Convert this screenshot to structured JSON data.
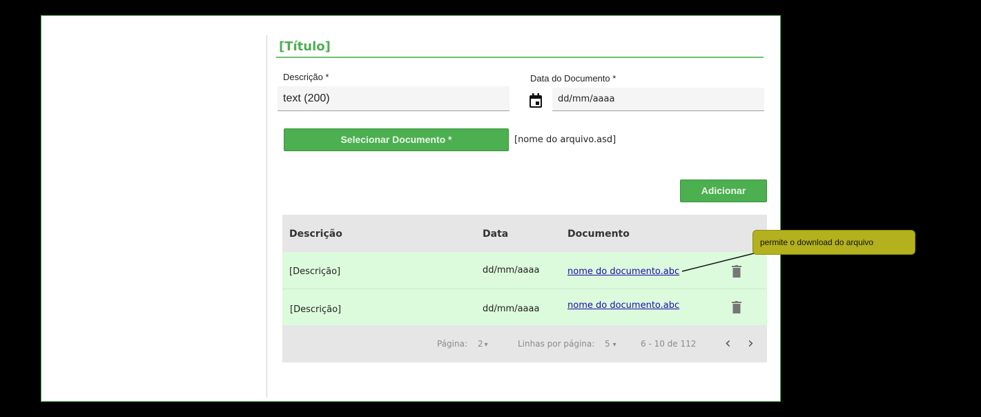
{
  "form": {
    "title": "[Título]",
    "descricao_label": "Descrição *",
    "descricao_value": "text (200)",
    "data_label": "Data do Documento *",
    "data_placeholder": "dd/mm/aaaa",
    "select_button_label": "Selecionar Documento *",
    "file_name": "[nome do arquivo.asd]",
    "add_button_label": "Adicionar"
  },
  "table": {
    "headers": [
      "Descrição",
      "Data",
      "Documento"
    ],
    "rows": [
      {
        "descricao": "[Descrição]",
        "data": "dd/mm/aaaa",
        "documento": "nome do documento.abc"
      },
      {
        "descricao": "[Descrição]",
        "data": "dd/mm/aaaa",
        "documento": "nome do documento.abc"
      }
    ],
    "footer": {
      "page_label": "Página:",
      "page_value": "2",
      "rows_label": "Linhas por página:",
      "rows_value": "5",
      "range_text": "6 - 10 de 112",
      "prev_icon": "‹",
      "next_icon": "›",
      "dropdown_arrow": "▾"
    }
  },
  "callout": {
    "text": "permite o download do arquivo"
  },
  "colors": {
    "accent": "#4caf50",
    "row_bg": "#dcfadc",
    "callout_bg": "#b3b11d"
  },
  "icons": [
    "calendar-icon",
    "trash-icon",
    "chevron-left-icon",
    "chevron-right-icon",
    "dropdown-arrow-icon"
  ]
}
